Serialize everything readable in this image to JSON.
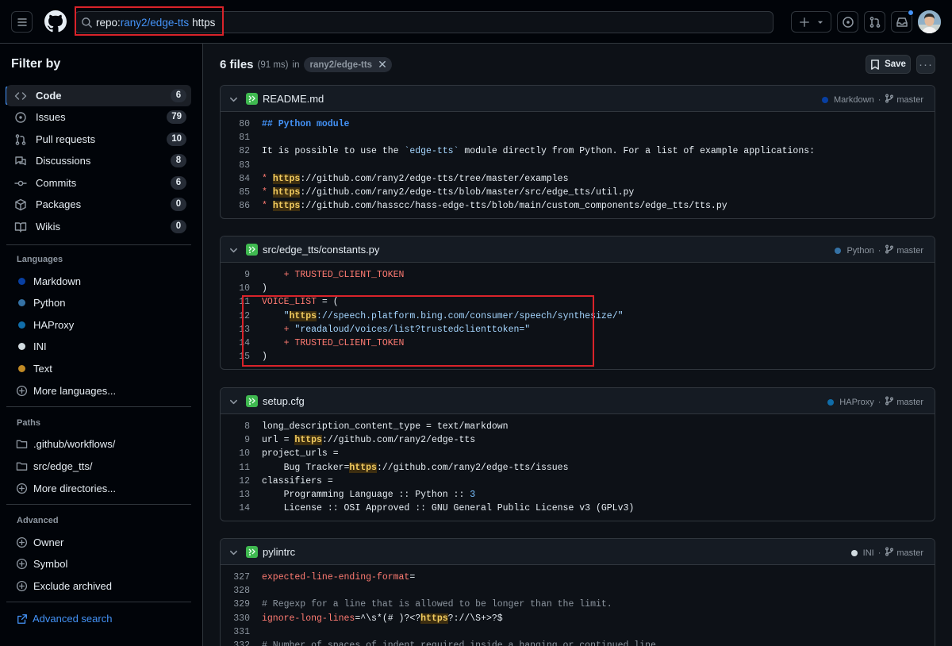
{
  "search": {
    "qualifier": "repo:",
    "repo": "rany2/edge-tts",
    "term": "https"
  },
  "sidebar": {
    "title": "Filter by",
    "types": [
      {
        "label": "Code",
        "count": "6",
        "icon": "code-icon"
      },
      {
        "label": "Issues",
        "count": "79",
        "icon": "issue-icon"
      },
      {
        "label": "Pull requests",
        "count": "10",
        "icon": "pull-request-icon"
      },
      {
        "label": "Discussions",
        "count": "8",
        "icon": "discussion-icon"
      },
      {
        "label": "Commits",
        "count": "6",
        "icon": "commit-icon"
      },
      {
        "label": "Packages",
        "count": "0",
        "icon": "package-icon"
      },
      {
        "label": "Wikis",
        "count": "0",
        "icon": "book-icon"
      }
    ],
    "languages_title": "Languages",
    "languages": [
      {
        "label": "Markdown",
        "color": "#083fa1"
      },
      {
        "label": "Python",
        "color": "#3572A5"
      },
      {
        "label": "HAProxy",
        "color": "#106da9"
      },
      {
        "label": "INI",
        "color": "#d1dbe0"
      },
      {
        "label": "Text",
        "color": "#c08a25"
      }
    ],
    "more_languages": "More languages...",
    "paths_title": "Paths",
    "paths": [
      ".github/workflows/",
      "src/edge_tts/"
    ],
    "more_directories": "More directories...",
    "advanced_title": "Advanced",
    "advanced": [
      "Owner",
      "Symbol",
      "Exclude archived"
    ],
    "advanced_search": "Advanced search"
  },
  "results": {
    "count": "6 files",
    "time": "(91 ms)",
    "in_label": "in",
    "repo_chip": "rany2/edge-tts",
    "save_label": "Save"
  },
  "files": [
    {
      "name": "README.md",
      "language": "Markdown",
      "lang_color": "#083fa1",
      "branch": "master",
      "lines": [
        {
          "n": "80",
          "t": "## Python module"
        },
        {
          "n": "81",
          "t": ""
        },
        {
          "n": "82",
          "pre": "It is possible to use the ",
          "code": "`edge-tts`",
          "post": " module directly from Python. For a list of example applications:"
        },
        {
          "n": "83",
          "t": ""
        },
        {
          "n": "84",
          "bullet": "* ",
          "hl": "https",
          "post": "://github.com/rany2/edge-tts/tree/master/examples"
        },
        {
          "n": "85",
          "bullet": "* ",
          "hl": "https",
          "post": "://github.com/rany2/edge-tts/blob/master/src/edge_tts/util.py"
        },
        {
          "n": "86",
          "bullet": "* ",
          "hl": "https",
          "post": "://github.com/hasscc/hass-edge-tts/blob/main/custom_components/edge_tts/tts.py"
        }
      ]
    },
    {
      "name": "src/edge_tts/constants.py",
      "language": "Python",
      "lang_color": "#3572A5",
      "branch": "master",
      "lines": [
        {
          "n": "9",
          "op": "    + ",
          "pre": "TRUSTED_CLIENT_TOKEN"
        },
        {
          "n": "10",
          "t": ")"
        },
        {
          "n": "11",
          "pre": "VOICE_LIST ",
          "op": "=",
          "post": " ("
        },
        {
          "n": "12",
          "indent": "    ",
          "q": "\"",
          "hl": "https",
          "str": "://speech.platform.bing.com/consumer/speech/synthesize/\""
        },
        {
          "n": "13",
          "op": "    + ",
          "str": "\"readaloud/voices/list?trustedclienttoken=\""
        },
        {
          "n": "14",
          "op": "    + ",
          "pre": "TRUSTED_CLIENT_TOKEN"
        },
        {
          "n": "15",
          "t": ")"
        }
      ]
    },
    {
      "name": "setup.cfg",
      "language": "HAProxy",
      "lang_color": "#106da9",
      "branch": "master",
      "lines": [
        {
          "n": "8",
          "t": "long_description_content_type = text/markdown"
        },
        {
          "n": "9",
          "pre": "url = ",
          "hl": "https",
          "post": "://github.com/rany2/edge-tts"
        },
        {
          "n": "10",
          "t": "project_urls ="
        },
        {
          "n": "11",
          "pre": "    Bug Tracker=",
          "hl": "https",
          "post": "://github.com/rany2/edge-tts/issues"
        },
        {
          "n": "12",
          "t": "classifiers ="
        },
        {
          "n": "13",
          "pre": "    Programming Language :: Python :: ",
          "num": "3"
        },
        {
          "n": "14",
          "t": "    License :: OSI Approved :: GNU General Public License v3 (GPLv3)"
        }
      ]
    },
    {
      "name": "pylintrc",
      "language": "INI",
      "lang_color": "#d1dbe0",
      "branch": "master",
      "lines": [
        {
          "n": "327",
          "key": "expected-line-ending-format",
          "post": "="
        },
        {
          "n": "328",
          "t": ""
        },
        {
          "n": "329",
          "comment": "# Regexp for a line that is allowed to be longer than the limit."
        },
        {
          "n": "330",
          "key": "ignore-long-lines",
          "post": "=^\\s*(# )?<?",
          "hl": "https",
          "tail": "?://\\S+>?$"
        },
        {
          "n": "331",
          "t": ""
        },
        {
          "n": "332",
          "comment": "# Number of spaces of indent required inside a hanging or continued line."
        }
      ]
    }
  ],
  "colors": {
    "accent": "#4493f8",
    "highlight": "#f2cc60",
    "redbox": "#d9232a"
  }
}
